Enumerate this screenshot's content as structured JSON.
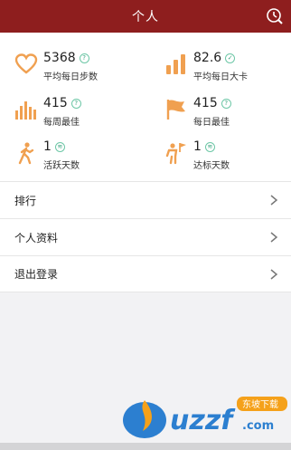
{
  "header": {
    "title": "个人"
  },
  "stats": [
    {
      "value": "5368",
      "label": "平均每日步数",
      "icon": "heart-icon",
      "badge": "?"
    },
    {
      "value": "82.6",
      "label": "平均每日大卡",
      "icon": "bars-icon",
      "badge": "✓"
    },
    {
      "value": "415",
      "label": "每周最佳",
      "icon": "bar-chart-icon",
      "badge": "?"
    },
    {
      "value": "415",
      "label": "每日最佳",
      "icon": "flag-icon",
      "badge": "?"
    },
    {
      "value": "1",
      "label": "活跃天数",
      "icon": "walking-person-icon",
      "badge": "≋"
    },
    {
      "value": "1",
      "label": "达标天数",
      "icon": "person-flag-icon",
      "badge": "≋"
    }
  ],
  "menu": [
    {
      "label": "排行"
    },
    {
      "label": "个人资料"
    },
    {
      "label": "退出登录"
    }
  ],
  "watermark": {
    "text": "uzzf.com",
    "tagline": "东坡下载"
  },
  "colors": {
    "header": "#8e1e1e",
    "accent": "#f0a050",
    "badge": "#6dc7a6"
  }
}
